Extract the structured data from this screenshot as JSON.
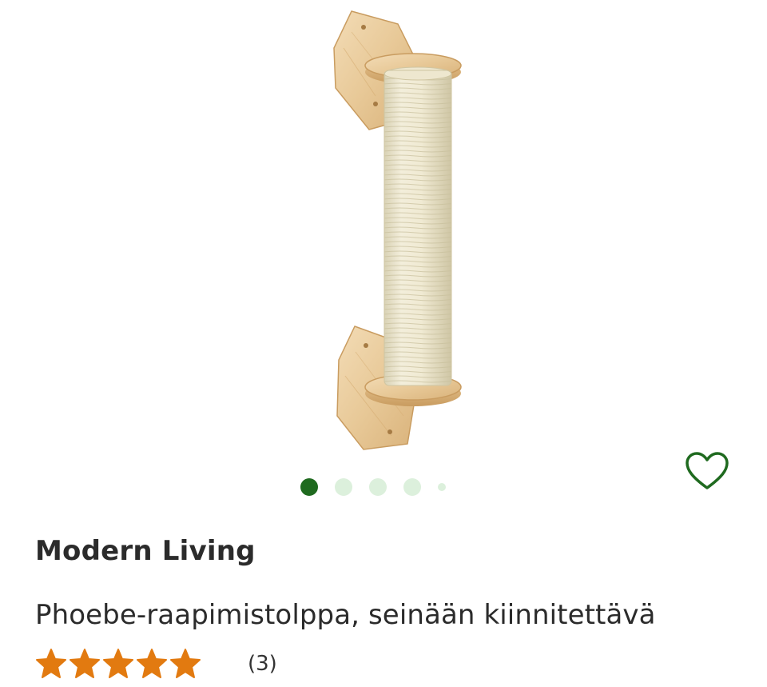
{
  "product": {
    "brand": "Modern Living",
    "title": "Phoebe-raapimistolppa, seinään kiinnitettävä",
    "rating_value": 5,
    "rating_max": 5,
    "review_count": "(3)",
    "image_alt": "Phoebe-raapimistolppa"
  },
  "gallery": {
    "total_dots": 5,
    "active_index": 0
  },
  "icons": {
    "favorite": "heart-outline-icon",
    "rating": "star-icon"
  },
  "colors": {
    "primary_green": "#1f6a1f",
    "dot_inactive": "#dcf0dc",
    "star_orange": "#e27a10",
    "text": "#2b2b2b"
  }
}
